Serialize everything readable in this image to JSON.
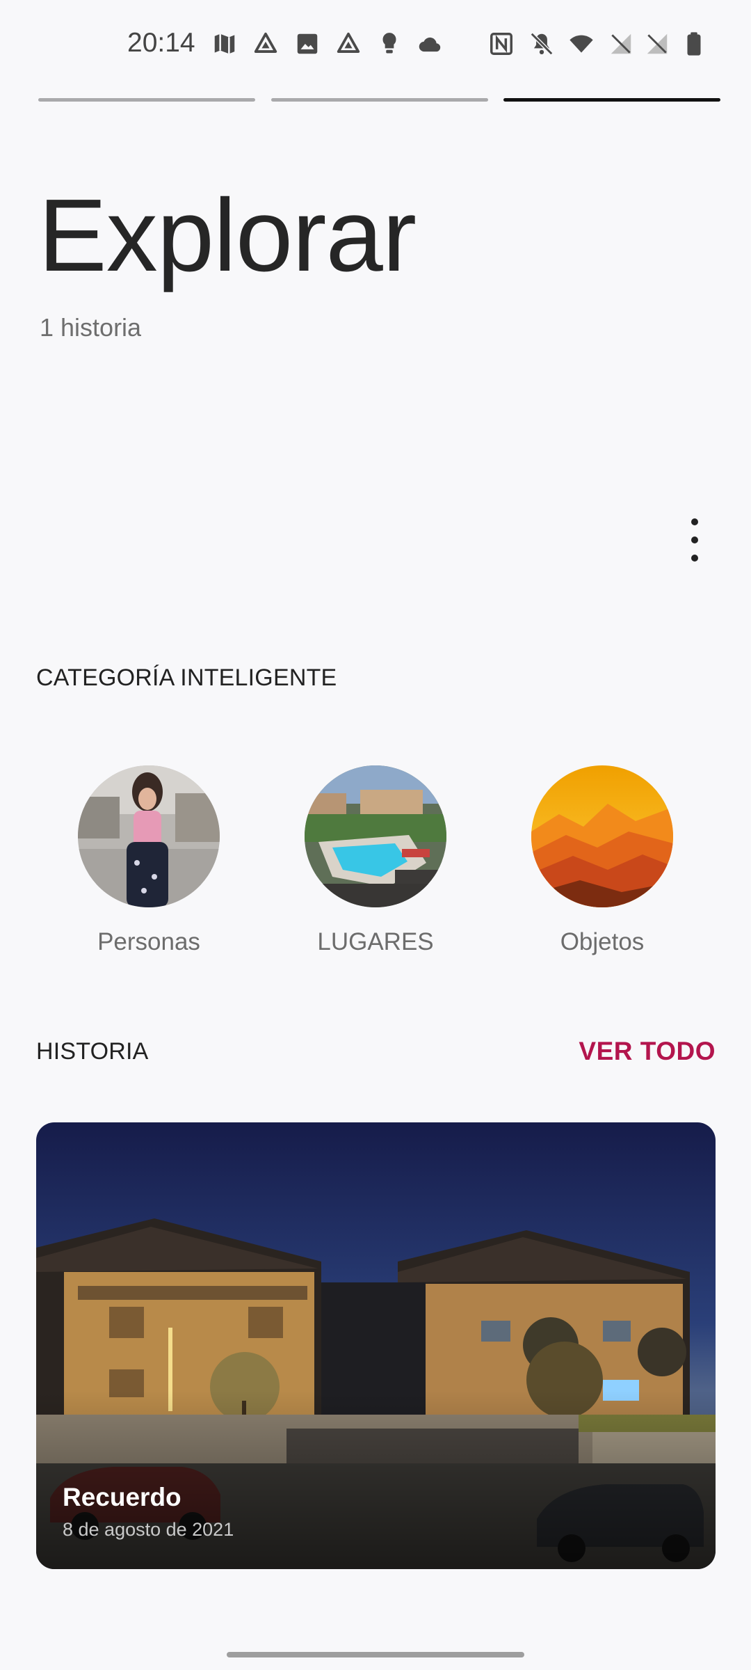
{
  "status_bar": {
    "time": "20:14",
    "icons": [
      "maps-icon",
      "drive-icon",
      "image-icon",
      "drive-icon",
      "bulb-icon",
      "cloud-icon",
      "nfc-icon",
      "bell-off-icon",
      "wifi-icon",
      "signal-off-icon",
      "signal-off-icon",
      "battery-icon"
    ]
  },
  "story_progress": {
    "segments": 3,
    "active_index": 2
  },
  "header": {
    "title": "Explorar",
    "subtitle": "1 historia"
  },
  "smart_category": {
    "title": "CATEGORÍA INTELIGENTE",
    "items": [
      {
        "label": "Personas"
      },
      {
        "label": "LUGARES"
      },
      {
        "label": "Objetos"
      }
    ]
  },
  "history": {
    "title": "HISTORIA",
    "see_all_label": "VER TODO",
    "card": {
      "title": "Recuerdo",
      "date": "8 de agosto de 2021"
    }
  },
  "colors": {
    "background": "#f8f8fa",
    "accent": "#b3154d",
    "text": "#222222"
  }
}
